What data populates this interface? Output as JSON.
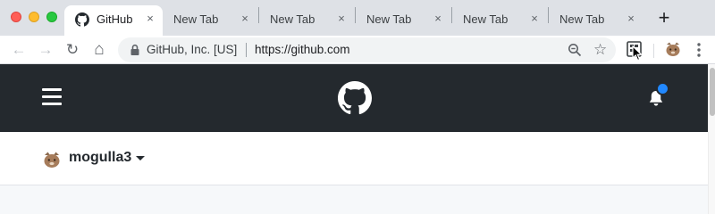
{
  "browser": {
    "tabs": [
      {
        "label": "GitHub",
        "active": true,
        "icon": "github-icon",
        "close": "×"
      },
      {
        "label": "New Tab",
        "active": false,
        "close": "×"
      },
      {
        "label": "New Tab",
        "active": false,
        "close": "×"
      },
      {
        "label": "New Tab",
        "active": false,
        "close": "×"
      },
      {
        "label": "New Tab",
        "active": false,
        "close": "×"
      },
      {
        "label": "New Tab",
        "active": false,
        "close": "×"
      }
    ],
    "new_tab": "+",
    "toolbar": {
      "back": "←",
      "forward": "→",
      "reload": "↻",
      "home": "⌂",
      "star": "☆"
    },
    "omnibox": {
      "site_identity": "GitHub, Inc. [US]",
      "url": "https://github.com"
    }
  },
  "github": {
    "header": {
      "menu_icon": "hamburger-icon",
      "logo_icon": "github-logo-icon",
      "notification_icon": "bell-icon",
      "accent": "#2188ff",
      "background": "#24292e"
    },
    "account": {
      "username": "mogulla3"
    }
  },
  "colors": {
    "tabstrip": "#dee1e6",
    "omnibox": "#f1f3f4"
  }
}
